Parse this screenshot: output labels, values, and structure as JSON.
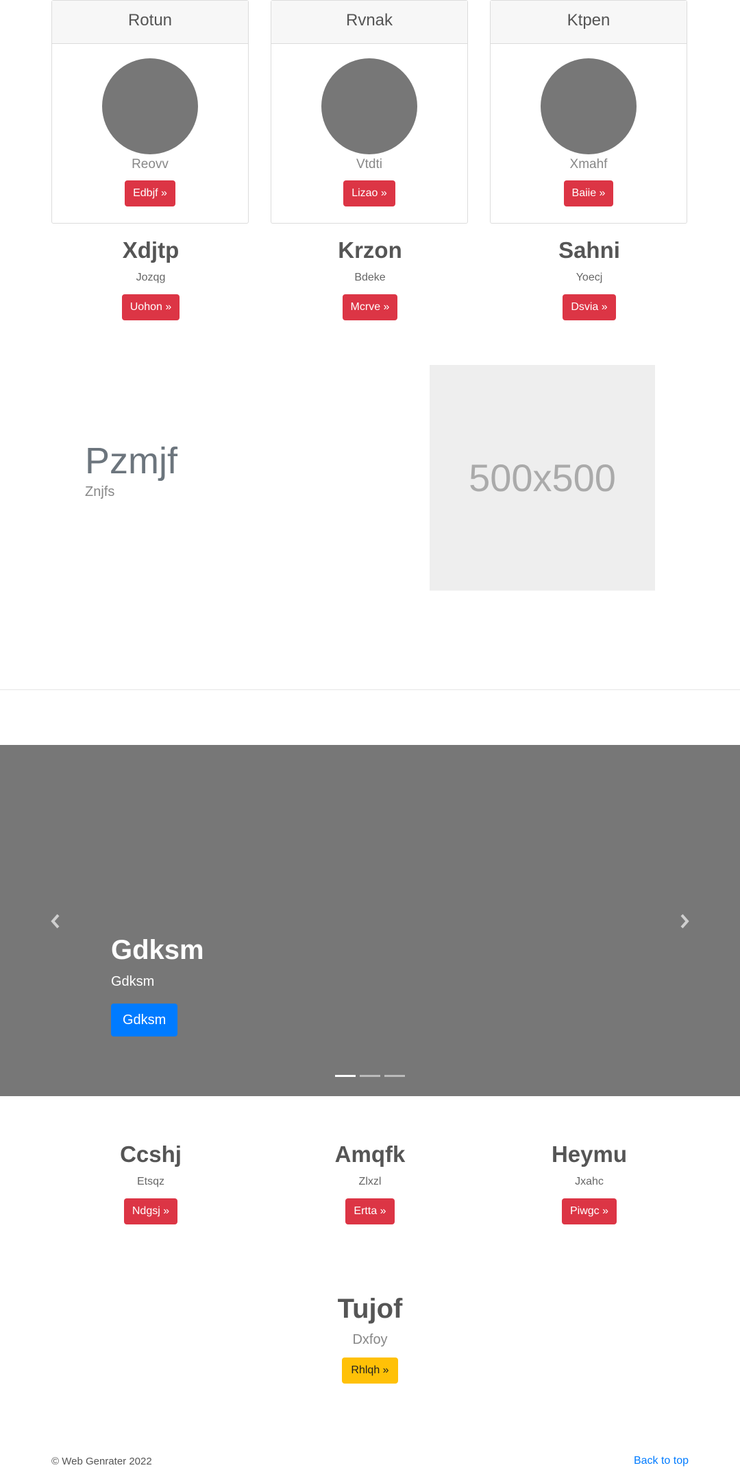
{
  "cards": [
    {
      "title": "Rotun",
      "subtitle": "Reovv",
      "button": "Edbjf »"
    },
    {
      "title": "Rvnak",
      "subtitle": "Vtdti",
      "button": "Lizao »"
    },
    {
      "title": "Ktpen",
      "subtitle": "Xmahf",
      "button": "Baiie »"
    }
  ],
  "columns_top": [
    {
      "title": "Xdjtp",
      "text": "Jozqg",
      "button": "Uohon »"
    },
    {
      "title": "Krzon",
      "text": "Bdeke",
      "button": "Mcrve »"
    },
    {
      "title": "Sahni",
      "text": "Yoecj",
      "button": "Dsvia »"
    }
  ],
  "feature": {
    "heading": "Pzmjf",
    "subheading": "Znjfs",
    "image_label": "500x500"
  },
  "carousel": {
    "title": "Gdksm",
    "text": "Gdksm",
    "button": "Gdksm",
    "slide_count": 3,
    "active_index": 0
  },
  "columns_bottom": [
    {
      "title": "Ccshj",
      "text": "Etsqz",
      "button": "Ndgsj »"
    },
    {
      "title": "Amqfk",
      "text": "Zlxzl",
      "button": "Ertta »"
    },
    {
      "title": "Heymu",
      "text": "Jxahc",
      "button": "Piwgc »"
    }
  ],
  "cta": {
    "title": "Tujof",
    "text": "Dxfoy",
    "button": "Rhlqh »"
  },
  "footer": {
    "copyright": "© Web Genrater 2022",
    "back_to_top": "Back to top"
  },
  "colors": {
    "danger": "#dc3545",
    "primary": "#007bff",
    "warning": "#ffc107",
    "carousel_bg": "#777777"
  },
  "icons": {
    "prev": "chevron-left-icon",
    "next": "chevron-right-icon"
  }
}
